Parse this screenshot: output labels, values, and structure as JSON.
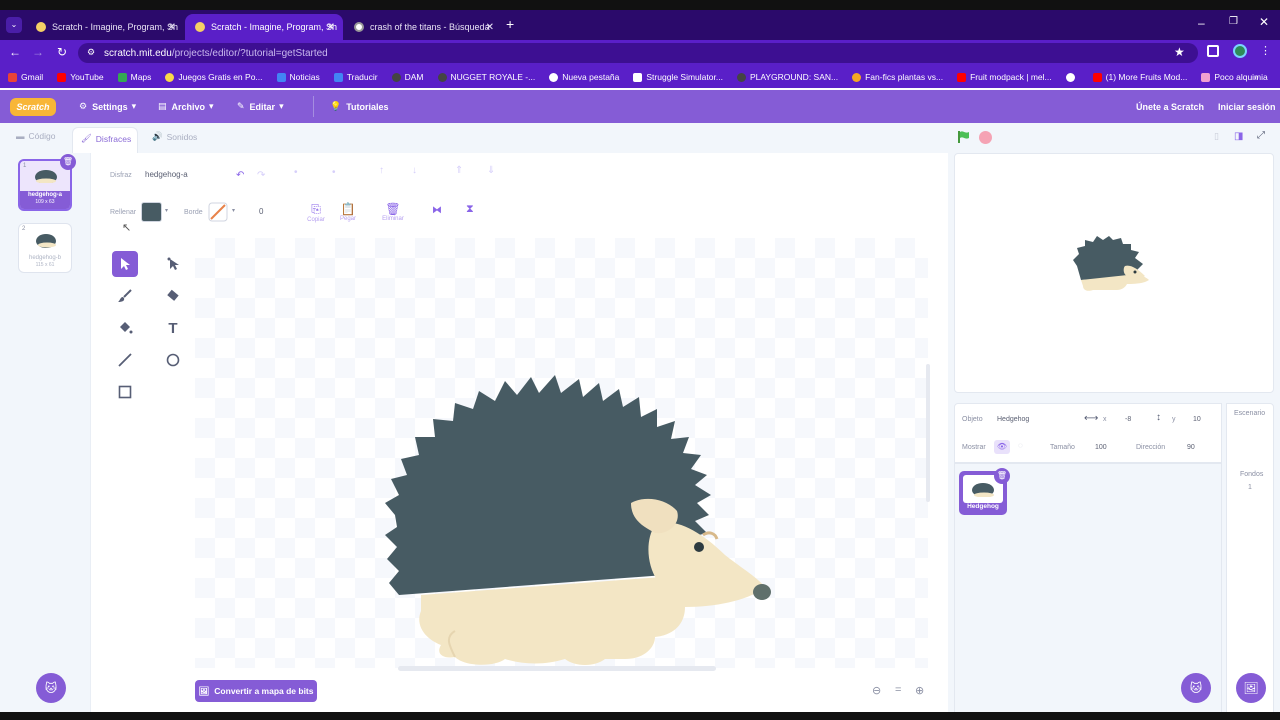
{
  "browser": {
    "tabs": [
      {
        "title": "Scratch - Imagine, Program, Sh",
        "active": false
      },
      {
        "title": "Scratch - Imagine, Program, Sh",
        "active": true
      },
      {
        "title": "crash of the titans - Búsqueda",
        "active": false
      }
    ],
    "url_host": "scratch.mit.edu",
    "url_path": "/projects/editor/?tutorial=getStarted",
    "bookmarks": [
      "Gmail",
      "YouTube",
      "Maps",
      "Juegos Gratis en Po...",
      "Noticias",
      "Traducir",
      "DAM",
      "NUGGET ROYALE -...",
      "Nueva pestaña",
      "Struggle Simulator...",
      "PLAYGROUND: SAN...",
      "Fan-fics plantas vs...",
      "Fruit modpack | mel...",
      "(1) More Fruits Mod...",
      "Poco alquimia"
    ]
  },
  "menubar": {
    "logo": "Scratch",
    "settings": "Settings",
    "file": "Archivo",
    "edit": "Editar",
    "tutorials": "Tutoriales",
    "join": "Únete a Scratch",
    "signin": "Iniciar sesión"
  },
  "editor_tabs": {
    "code": "Código",
    "costumes": "Disfraces",
    "sounds": "Sonidos"
  },
  "costumes": [
    {
      "num": "1",
      "name": "hedgehog-a",
      "size": "109 x 63",
      "selected": true
    },
    {
      "num": "2",
      "name": "hedgehog-b",
      "size": "115 x 61",
      "selected": false
    }
  ],
  "paint": {
    "costume_label": "Disfraz",
    "costume_name": "hedgehog-a",
    "fill_label": "Rellenar",
    "fill_color": "#475b63",
    "outline_label": "Borde",
    "outline_width": "0",
    "copy": "Copiar",
    "paste": "Pegar",
    "delete": "Eliminar",
    "convert": "Convertir a mapa de bits"
  },
  "sprite": {
    "label_sprite": "Objeto",
    "name": "Hedgehog",
    "x": "-8",
    "y": "10",
    "label_show": "Mostrar",
    "label_size": "Tamaño",
    "size": "100",
    "label_direction": "Dirección",
    "direction": "90",
    "card_name": "Hedgehog"
  },
  "stage_panel": {
    "title": "Escenario",
    "backdrops_label": "Fondos",
    "backdrops_count": "1"
  },
  "colors": {
    "accent": "#855cd6",
    "hedgehog_body": "#475b63",
    "hedgehog_belly": "#f3e6c5"
  }
}
